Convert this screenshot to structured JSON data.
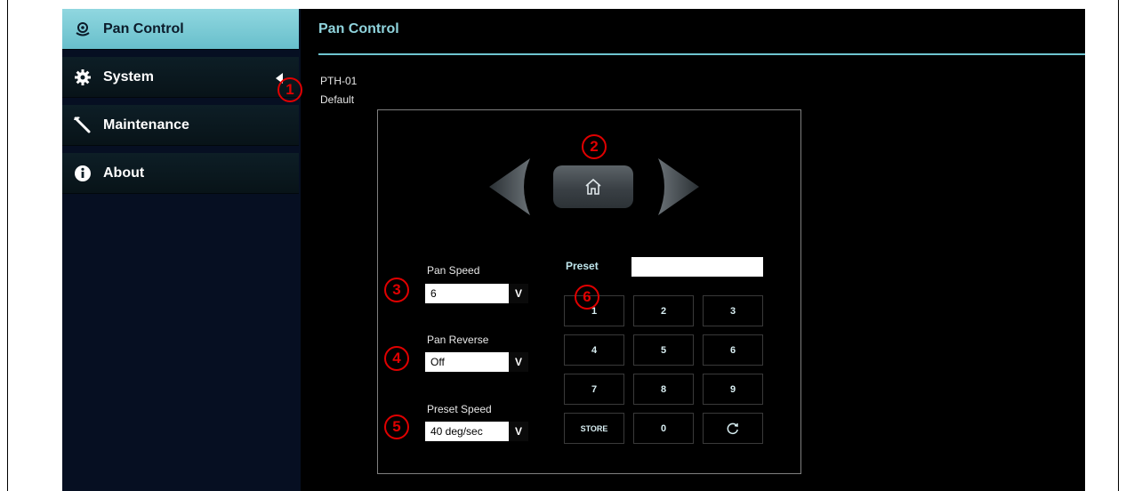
{
  "sidebar": {
    "items": [
      {
        "label": "Pan Control",
        "icon": "camera-pan-icon",
        "active": true
      },
      {
        "label": "System",
        "icon": "gear-icon",
        "active": false
      },
      {
        "label": "Maintenance",
        "icon": "wrench-icon",
        "active": false
      },
      {
        "label": "About",
        "icon": "info-icon",
        "active": false
      }
    ]
  },
  "header": {
    "title": "Pan Control"
  },
  "device": {
    "model": "PTH-01",
    "profile": "Default"
  },
  "controls": {
    "pan_speed": {
      "label": "Pan Speed",
      "value": "6"
    },
    "pan_reverse": {
      "label": "Pan Reverse",
      "value": "Off"
    },
    "preset_speed": {
      "label": "Preset Speed",
      "value": "40 deg/sec"
    },
    "dropdown_glyph": "V"
  },
  "preset": {
    "label": "Preset",
    "input_value": "",
    "keys": [
      "1",
      "2",
      "3",
      "4",
      "5",
      "6",
      "7",
      "8",
      "9",
      "STORE",
      "0",
      "refresh-icon"
    ]
  },
  "callouts": [
    "1",
    "2",
    "3",
    "4",
    "5",
    "6"
  ],
  "colors": {
    "accent": "#8fd3dc",
    "callout": "#e00000",
    "background": "#000000"
  }
}
